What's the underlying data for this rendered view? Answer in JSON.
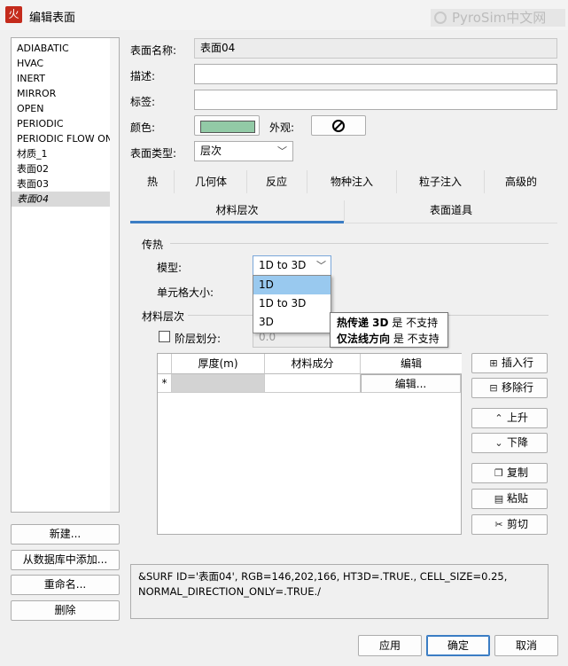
{
  "window": {
    "title": "编辑表面",
    "app_icon": "火",
    "watermark": "PyroSim中文网"
  },
  "surface_list": {
    "items": [
      "ADIABATIC",
      "HVAC",
      "INERT",
      "MIRROR",
      "OPEN",
      "PERIODIC",
      "PERIODIC FLOW ONLY",
      "材质_1",
      "表面02",
      "表面03",
      "表面04"
    ],
    "selected_index": 10
  },
  "left_buttons": {
    "new": "新建...",
    "add_from_db": "从数据库中添加...",
    "rename": "重命名...",
    "delete": "删除"
  },
  "form": {
    "surface_name_label": "表面名称:",
    "surface_name_value": "表面04",
    "description_label": "描述:",
    "description_value": "",
    "tag_label": "标签:",
    "tag_value": "",
    "color_label": "颜色:",
    "color_hex": "#92caa6",
    "appearance_label": "外观:",
    "surface_type_label": "表面类型:",
    "surface_type_value": "层次"
  },
  "tabs_row1": [
    "热",
    "几何体",
    "反应",
    "物种注入",
    "粒子注入",
    "高级的"
  ],
  "tabs_row2": [
    "材料层次",
    "表面道具"
  ],
  "heat_transfer": {
    "group_label": "传热",
    "model_label": "模型:",
    "model_value": "1D to 3D",
    "cell_size_label": "单元格大小:",
    "options": [
      "1D",
      "1D to 3D",
      "3D"
    ],
    "highlighted_option": "1D"
  },
  "tooltip": {
    "line1_bold": "热传递 3D",
    "line1_rest": " 是 不支持",
    "line2_bold": "仅法线方向",
    "line2_rest": " 是 不支持"
  },
  "material_layers": {
    "group_label": "材料层次",
    "step_label": "阶层划分:",
    "step_value": "0.0",
    "columns": [
      "厚度(m)",
      "材料成分",
      "编辑"
    ],
    "row_marker": "*",
    "edit_button": "编辑..."
  },
  "side_buttons": [
    {
      "icon": "insert-row-icon",
      "glyph": "⊞",
      "label": "插入行"
    },
    {
      "icon": "remove-row-icon",
      "glyph": "⊟",
      "label": "移除行"
    },
    {
      "icon": "move-up-icon",
      "glyph": "⌃",
      "label": "上升"
    },
    {
      "icon": "move-down-icon",
      "glyph": "⌄",
      "label": "下降"
    },
    {
      "icon": "copy-icon",
      "glyph": "❐",
      "label": "复制"
    },
    {
      "icon": "paste-icon",
      "glyph": "▤",
      "label": "粘贴"
    },
    {
      "icon": "cut-icon",
      "glyph": "✂",
      "label": "剪切"
    }
  ],
  "code_preview": {
    "line1": "&SURF ID='表面04', RGB=146,202,166, HT3D=.TRUE., CELL_SIZE=0.25,",
    "line2": "NORMAL_DIRECTION_ONLY=.TRUE./"
  },
  "footer_buttons": {
    "apply": "应用",
    "ok": "确定",
    "cancel": "取消"
  },
  "colors": {
    "accent": "#3b7dc4",
    "highlight": "#99c9ef"
  }
}
